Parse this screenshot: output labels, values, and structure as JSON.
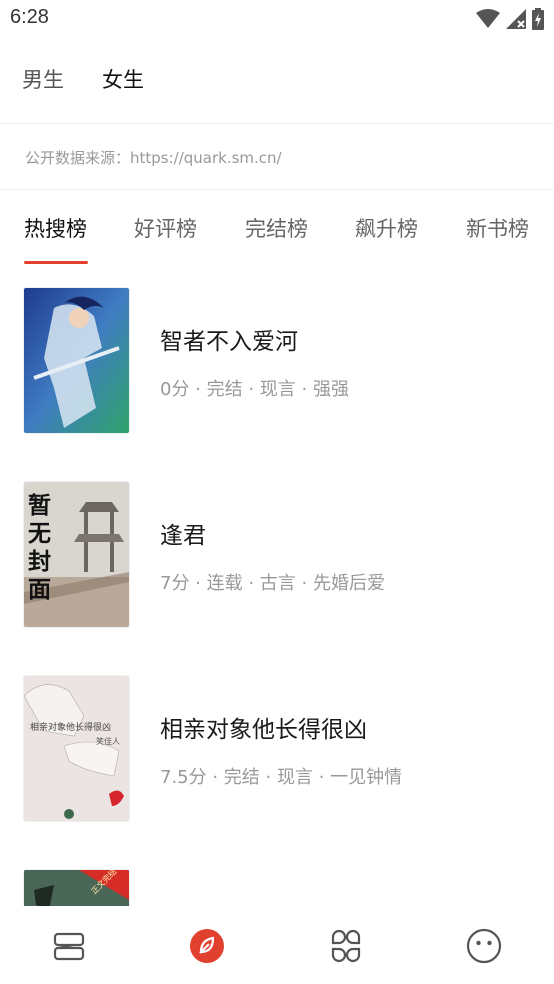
{
  "status_bar": {
    "time": "6:28"
  },
  "gender_tabs": [
    {
      "label": "男生",
      "active": false
    },
    {
      "label": "女生",
      "active": true
    }
  ],
  "source_note": "公开数据来源：https://quark.sm.cn/",
  "rank_tabs": [
    {
      "label": "热搜榜",
      "active": true
    },
    {
      "label": "好评榜",
      "active": false
    },
    {
      "label": "完结榜",
      "active": false
    },
    {
      "label": "飙升榜",
      "active": false
    },
    {
      "label": "新书榜",
      "active": false
    }
  ],
  "books": [
    {
      "title": "智者不入爱河",
      "meta": "0分 · 完结 · 现言 · 强强"
    },
    {
      "title": "逢君",
      "meta": "7分 · 连载 · 古言 · 先婚后爱",
      "cover_text": "暂无封面"
    },
    {
      "title": "相亲对象他长得很凶",
      "meta": "7.5分 · 完结 · 现言 · 一见钟情",
      "cover_text": "相亲对象他长得很凶",
      "cover_author": "笑佳人"
    },
    {
      "title": "",
      "meta": "",
      "cover_badge": "正文完结"
    }
  ],
  "colors": {
    "accent": "#e2402f",
    "text_primary": "#1a1a1a",
    "text_secondary": "#999999"
  },
  "bottom_nav": [
    {
      "icon": "bookshelf-icon",
      "active": false
    },
    {
      "icon": "discover-icon",
      "active": true
    },
    {
      "icon": "category-icon",
      "active": false
    },
    {
      "icon": "profile-icon",
      "active": false
    }
  ]
}
